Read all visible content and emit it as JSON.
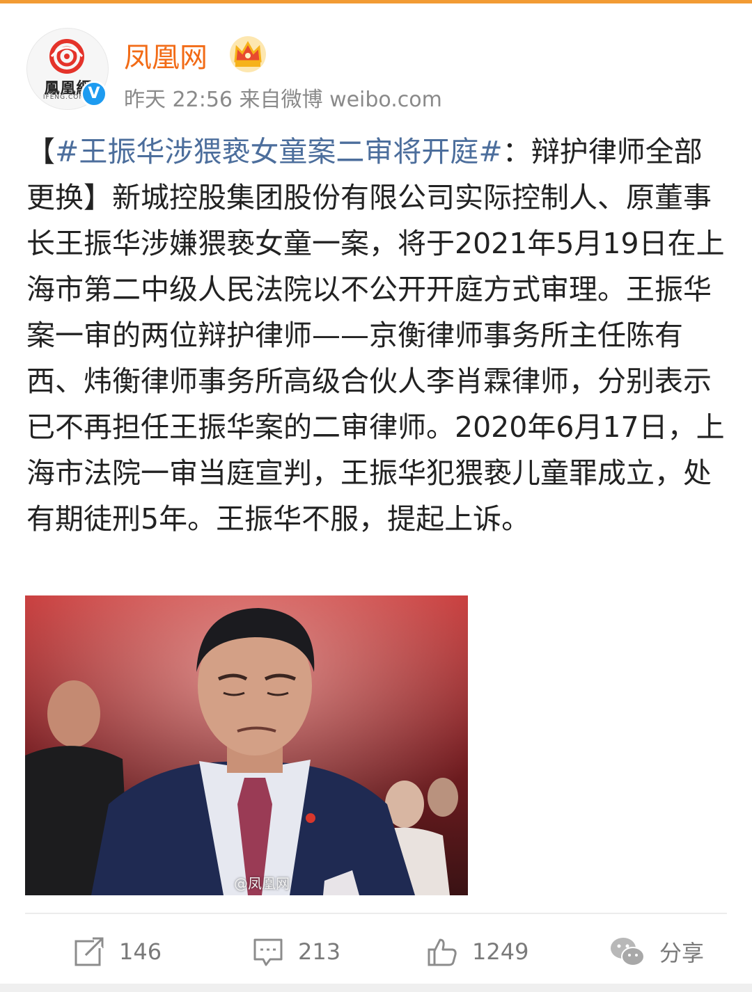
{
  "author": {
    "name": "凤凰网",
    "avatar_caption": "鳳凰網",
    "avatar_sub": "IFENG.COM",
    "verified_mark": "V",
    "meta": "昨天 22:56 来自微博 weibo.com",
    "badge_icon": "crown-icon"
  },
  "post": {
    "open_bracket": "【",
    "hashtag": "#王振华涉猥亵女童案二审将开庭#",
    "headline_rest": "：辩护律师全部更换】",
    "body": "新城控股集团股份有限公司实际控制人、原董事长王振华涉嫌猥亵女童一案，将于2021年5月19日在上海市第二中级人民法院以不公开开庭方式审理。王振华案一审的两位辩护律师——京衡律师事务所主任陈有西、炜衡律师事务所高级合伙人李肖霖律师，分别表示已不再担任王振华案的二审律师。2020年6月17日，上海市法院一审当庭宣判，王振华犯猥亵儿童罪成立，处有期徒刑5年。王振华不服，提起上诉。",
    "image_watermark": "@凤凰网"
  },
  "actions": [
    {
      "icon": "repost-icon",
      "label": "146"
    },
    {
      "icon": "comment-icon",
      "label": "213"
    },
    {
      "icon": "like-icon",
      "label": "1249"
    },
    {
      "icon": "wechat-share-icon",
      "label": "分享"
    }
  ],
  "colors": {
    "accent_bar": "#f29b34",
    "username": "#f26b16",
    "hashtag": "#4c6e9c",
    "verified": "#1d9bf0"
  }
}
